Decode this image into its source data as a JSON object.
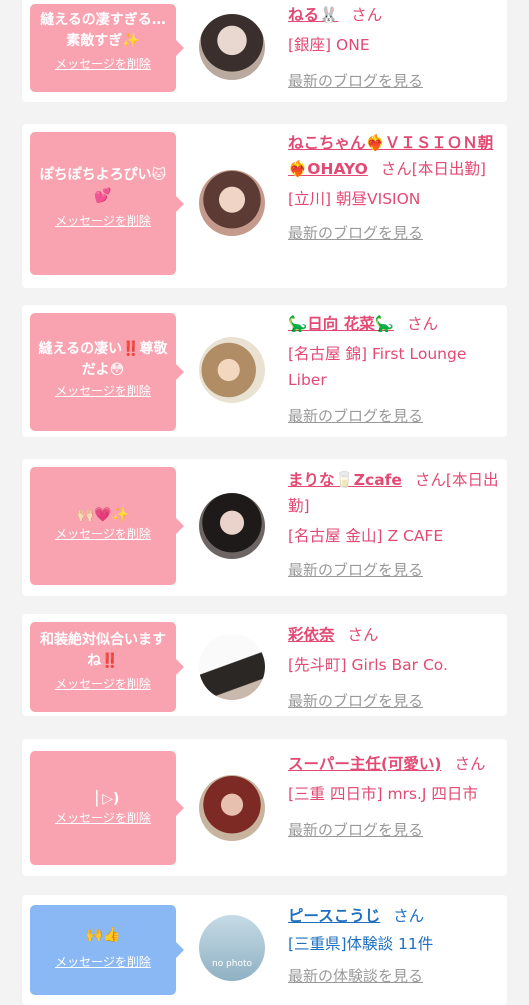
{
  "items": [
    {
      "message": "縫えるの凄すぎる…素敵すぎ✨",
      "delete_label": "メッセージを削除",
      "name": "ねる🐰",
      "honorific": "さん",
      "status": "",
      "shop": "[銀座] ONE",
      "link": "最新のブログを見る",
      "colors": {
        "bubble": "#f9a3b1",
        "accent": "#e24a73"
      }
    },
    {
      "message": "ぽちぽちよろぴい🐱💕",
      "delete_label": "メッセージを削除",
      "name": "ねこちゃん❤️‍🔥ＶＩＳＩＯＮ朝❤️‍🔥OHAYO",
      "honorific": "さん",
      "status": "[本日出勤]",
      "shop": "[立川] 朝昼VISION",
      "link": "最新のブログを見る"
    },
    {
      "message": "縫えるの凄い‼️尊敬だよ😳",
      "delete_label": "メッセージを削除",
      "name": "🦕日向 花菜🦕",
      "honorific": "さん",
      "status": "",
      "shop": "[名古屋 錦] First Lounge Liber",
      "link": "最新のブログを見る"
    },
    {
      "message": "🙌🏻💗✨",
      "delete_label": "メッセージを削除",
      "name": "まりな🥛Zcafe",
      "honorific": "さん",
      "status": "[本日出勤]",
      "shop": "[名古屋 金山] Z CAFE",
      "link": "最新のブログを見る"
    },
    {
      "message": "和装絶対似合いますね‼️",
      "delete_label": "メッセージを削除",
      "name": "彩依奈",
      "honorific": "さん",
      "status": "",
      "shop": "[先斗町] Girls Bar Co.",
      "link": "最新のブログを見る"
    },
    {
      "message": "▕ ▷)",
      "delete_label": "メッセージを削除",
      "name": "スーパー主任(可愛い)",
      "honorific": "さん",
      "status": "",
      "shop": "[三重 四日市] mrs.J 四日市",
      "link": "最新のブログを見る"
    },
    {
      "message": "🙌👍",
      "delete_label": "メッセージを削除",
      "name": "ピースこうじ",
      "honorific": "さん",
      "status": "",
      "shop": "[三重県]体験談 11件",
      "link": "最新の体験談を見る",
      "avatar_text": "no photo",
      "colors": {
        "bubble": "#8ab8f5",
        "accent": "#1e6fc0"
      }
    }
  ]
}
